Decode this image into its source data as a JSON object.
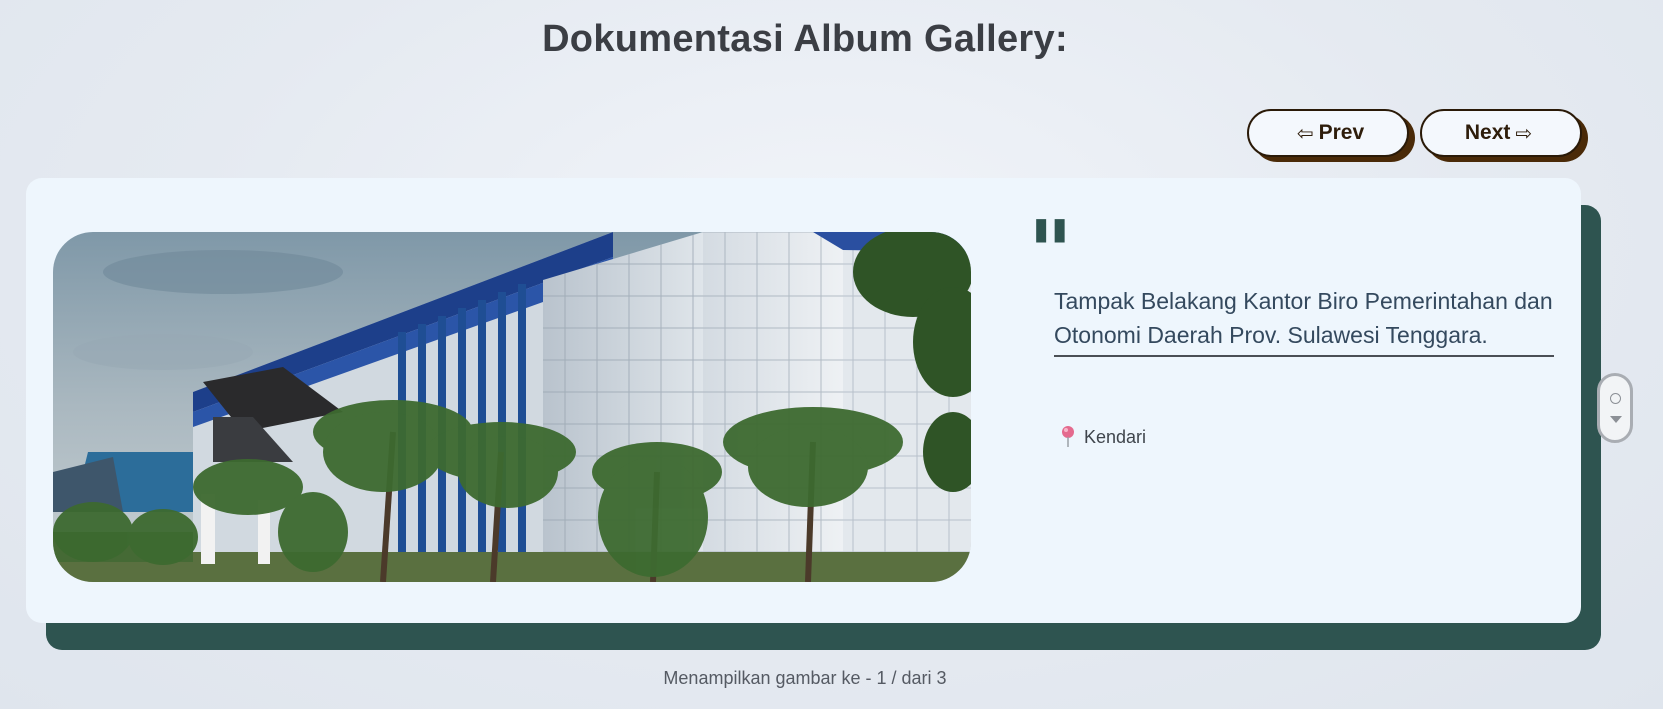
{
  "header": {
    "title": "Dokumentasi Album Gallery:"
  },
  "nav": {
    "prev_arrow": "⇦",
    "prev_label": "Prev",
    "next_label": "Next",
    "next_arrow": "⇨"
  },
  "slide": {
    "image_icon": "building-photo",
    "quote_mark": "\"",
    "caption": "Tampak Belakang Kantor Biro Pemerintahan dan Otonomi Daerah Prov. Sulawesi Tenggara.",
    "location_icon": "pin-icon",
    "location": "Kendari"
  },
  "footer": {
    "counter_text": "Menampilkan gambar ke - 1 / dari 3"
  },
  "colors": {
    "accent": "#2e5450",
    "button_shadow": "#4a2a08",
    "card_bg": "#eef6fd"
  }
}
